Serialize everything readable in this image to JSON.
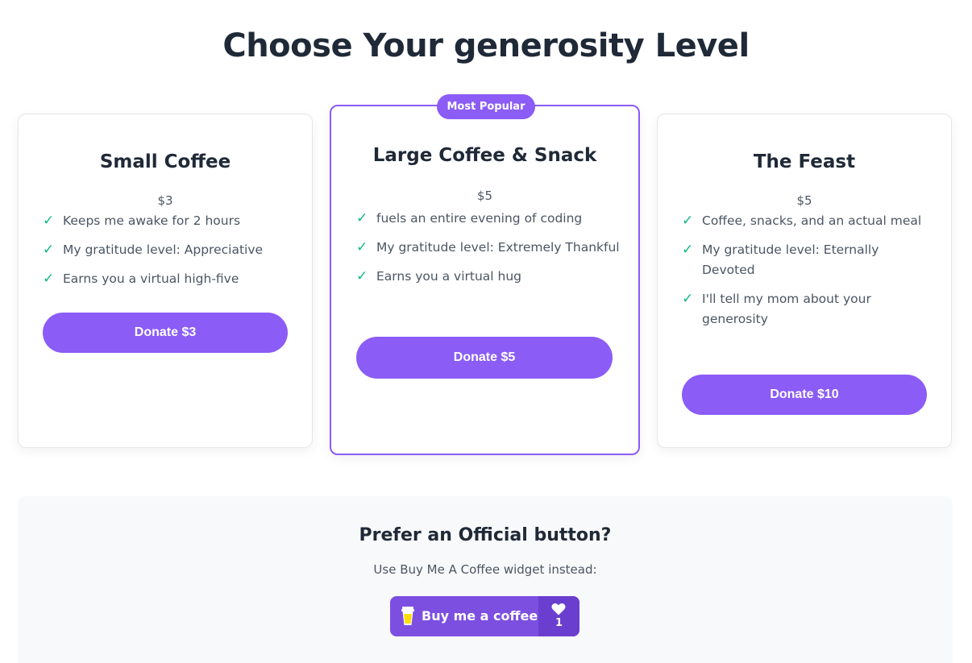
{
  "page": {
    "title": "Choose Your generosity Level"
  },
  "tiers": [
    {
      "title": "Small Coffee",
      "price": "$3",
      "features": [
        "Keeps me awake for 2 hours",
        "My gratitude level: Appreciative",
        "Earns you a virtual high-five"
      ],
      "button_label": "Donate $3"
    },
    {
      "badge": "Most Popular",
      "title": "Large Coffee & Snack",
      "price": "$5",
      "features": [
        "fuels an entire evening of coding",
        "My gratitude level: Extremely Thankful",
        "Earns you a virtual hug"
      ],
      "button_label": "Donate $5"
    },
    {
      "title": "The Feast",
      "price": "$5",
      "features": [
        "Coffee, snacks, and an actual meal",
        "My gratitude level: Eternally Devoted",
        "I'll tell my mom about your generosity"
      ],
      "button_label": "Donate $10"
    }
  ],
  "check_mark": "✓",
  "official": {
    "title": "Prefer an Official button?",
    "subtitle": "Use Buy Me A Coffee widget instead:",
    "widget": {
      "label": "Buy me a coffee",
      "count": "1",
      "icon": "coffee-cup-icon",
      "count_icon": "heart-icon"
    }
  },
  "colors": {
    "accent": "#8b5cf6",
    "check": "#10b981",
    "widget_bg": "#7c4fe0",
    "widget_count_bg": "#6a3fcf"
  }
}
